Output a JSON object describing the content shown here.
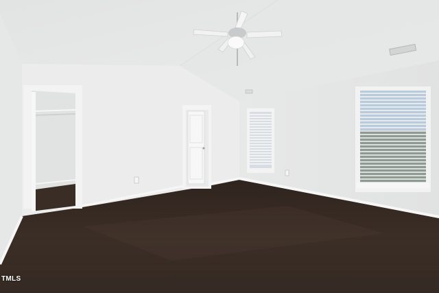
{
  "photo": {
    "subject": "empty-bedroom",
    "colors": {
      "ceiling": "#e6e7e7",
      "left_wall": "#e9eaea",
      "back_wall": "#ececec",
      "right_wall": "#e4e5e5",
      "floor": "#3a2c24",
      "baseboard": "#f4f4f4",
      "closet_interior": "#e1e2e2",
      "window_sky": "#b9cadb"
    }
  },
  "watermark": {
    "text": "TMLS"
  }
}
